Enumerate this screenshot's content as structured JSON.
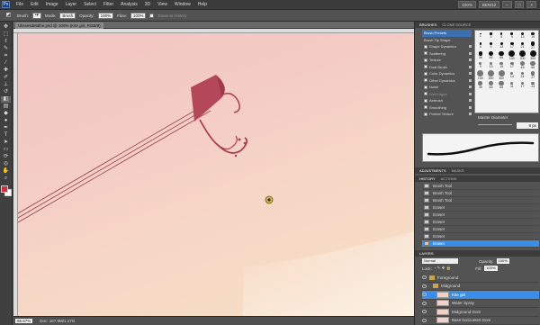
{
  "menubar": {
    "logo": "Ps",
    "items": [
      "File",
      "Edit",
      "Image",
      "Layer",
      "Select",
      "Filter",
      "Analysis",
      "3D",
      "View",
      "Window",
      "Help"
    ],
    "zoom": "100%",
    "workspace": "BENG2"
  },
  "options": {
    "brush_label": "Brush:",
    "mode_label": "Mode:",
    "mode_value": "Brush",
    "opacity_label": "Opacity:",
    "opacity_value": "100%",
    "flow_label": "Flow:",
    "flow_value": "100%",
    "option_label": "Erase to History"
  },
  "document": {
    "tab_title": "Ulissesdetalhe.psd @ 100% (Kite girl, RGB/8)",
    "status_zoom": "66.67%",
    "status_doc": "Doc: 16?.9M/1.17G"
  },
  "brushes_panel": {
    "tabs": [
      "Brushes",
      "Clone Source"
    ],
    "items": [
      {
        "label": "Brush Presets",
        "checked": false,
        "selected": true
      },
      {
        "label": "Brush Tip Shape",
        "checked": false,
        "selected": false
      },
      {
        "label": "Shape Dynamics",
        "checked": true,
        "selected": false
      },
      {
        "label": "Scattering",
        "checked": false,
        "selected": false
      },
      {
        "label": "Texture",
        "checked": false,
        "selected": false
      },
      {
        "label": "Dual Brush",
        "checked": false,
        "selected": false
      },
      {
        "label": "Color Dynamics",
        "checked": false,
        "selected": false
      },
      {
        "label": "Other Dynamics",
        "checked": false,
        "selected": false
      },
      {
        "label": "Noise",
        "checked": false,
        "selected": false
      },
      {
        "label": "Wet Edges",
        "checked": false,
        "selected": false
      },
      {
        "label": "Airbrush",
        "checked": false,
        "selected": false
      },
      {
        "label": "Smoothing",
        "checked": true,
        "selected": false
      },
      {
        "label": "Protect Texture",
        "checked": false,
        "selected": false
      }
    ],
    "brush_numbers": [
      "1",
      "3",
      "5",
      "9",
      "13",
      "19",
      "5",
      "9",
      "13",
      "17",
      "21",
      "27",
      "35",
      "45",
      "65",
      "100",
      "200",
      "300",
      "9",
      "13",
      "19",
      "17",
      "45",
      "65",
      "100",
      "200",
      "300",
      "14",
      "24",
      "27",
      "39",
      "46",
      "59",
      "11",
      "17",
      "23"
    ],
    "master_diameter_label": "Master Diameter",
    "master_diameter_value": "9 px"
  },
  "adjust_tabs": [
    "Adjustments",
    "Masks"
  ],
  "history_panel": {
    "tabs": [
      "History",
      "Actions"
    ],
    "items": [
      {
        "label": "Brush Tool",
        "selected": false
      },
      {
        "label": "Brush Tool",
        "selected": false
      },
      {
        "label": "Brush Tool",
        "selected": false
      },
      {
        "label": "Eraser",
        "selected": false
      },
      {
        "label": "Eraser",
        "selected": false
      },
      {
        "label": "Eraser",
        "selected": false
      },
      {
        "label": "Eraser",
        "selected": false
      },
      {
        "label": "Eraser",
        "selected": false
      },
      {
        "label": "Eraser",
        "selected": true
      }
    ]
  },
  "layers_panel": {
    "tabs": [
      "Layers"
    ],
    "blend_mode": "Normal",
    "opacity_label": "Opacity:",
    "opacity_value": "100%",
    "lock_label": "Lock:",
    "fill_label": "Fill:",
    "fill_value": "100%",
    "items": [
      {
        "label": "Foreground",
        "type": "group",
        "selected": false
      },
      {
        "label": "Midground",
        "type": "group",
        "selected": false
      },
      {
        "label": "Kite girl",
        "type": "layer",
        "selected": true
      },
      {
        "label": "Water Spray",
        "type": "layer",
        "selected": false
      },
      {
        "label": "Midground Gom",
        "type": "layer",
        "selected": false
      },
      {
        "label": "Base horizontes Gom",
        "type": "layer",
        "selected": false
      }
    ]
  },
  "colors": {
    "accent": "#3a8ee6",
    "foreground_swatch": "#c8323a",
    "background_swatch": "#ffffff",
    "kite": "#b4485a"
  },
  "toolbox": [
    "move-icon",
    "marquee-icon",
    "lasso-icon",
    "quick-select-icon",
    "crop-icon",
    "eyedropper-icon",
    "healing-icon",
    "brush-icon",
    "clone-stamp-icon",
    "history-brush-icon",
    "eraser-icon",
    "gradient-icon",
    "blur-icon",
    "dodge-icon",
    "pen-icon",
    "type-icon",
    "path-select-icon",
    "shape-icon",
    "3d-rotate-icon",
    "3d-orbit-icon",
    "hand-icon",
    "zoom-icon"
  ]
}
